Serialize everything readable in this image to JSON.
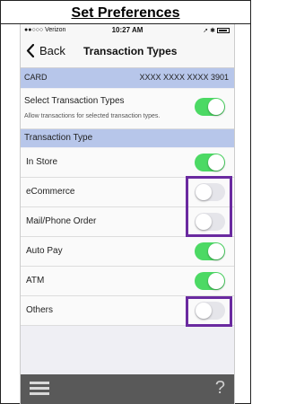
{
  "doc": {
    "title": "Set Preferences"
  },
  "status_bar": {
    "carrier": "●●○○○ Verizon",
    "time": "10:27 AM",
    "right": "➚ ✱"
  },
  "nav": {
    "back_label": "Back",
    "title": "Transaction Types"
  },
  "card": {
    "label": "CARD",
    "number": "XXXX XXXX XXXX 3901"
  },
  "select": {
    "title": "Select Transaction Types",
    "description": "Allow transactions for selected transaction types.",
    "enabled": true
  },
  "section": {
    "label": "Transaction Type"
  },
  "items": [
    {
      "label": "In Store",
      "enabled": true
    },
    {
      "label": "eCommerce",
      "enabled": false
    },
    {
      "label": "Mail/Phone Order",
      "enabled": false
    },
    {
      "label": "Auto Pay",
      "enabled": true
    },
    {
      "label": "ATM",
      "enabled": true
    },
    {
      "label": "Others",
      "enabled": false
    }
  ],
  "tab_bar": {
    "help": "?"
  },
  "colors": {
    "accent": "#4cd964",
    "section_bg": "#b7c6ea",
    "highlight": "#6a2aa0",
    "tab_bar": "#595959"
  }
}
